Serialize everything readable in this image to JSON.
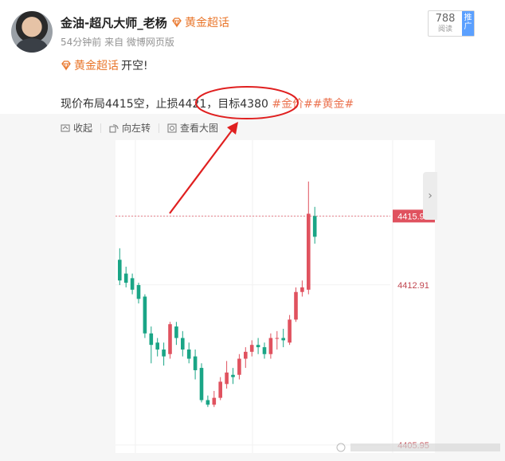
{
  "post": {
    "author": "金油-超凡大师_老杨",
    "badge": "黄金超话",
    "meta": "54分钟前  来自 微博网页版",
    "reads_count": "788",
    "reads_label": "阅读",
    "push_label": "推广",
    "topic": "黄金超话",
    "line1_text": "开空!",
    "line2_text": "现价布局4415空，止损4421，目标4380 ",
    "hashtags": "#金价##黄金#",
    "actions": {
      "collect": "收起",
      "rotate": "向左转",
      "view_large": "查看大图"
    }
  },
  "chart_data": {
    "type": "candlestick",
    "price_labels": [
      "4415.90",
      "4412.91",
      "4405.95"
    ],
    "current_price": 4415.9,
    "ylim": [
      4405.6,
      4419.2
    ],
    "candles": [
      {
        "o": 4414.0,
        "c": 4413.1,
        "h": 4414.5,
        "l": 4412.9
      },
      {
        "o": 4413.4,
        "c": 4413.0,
        "h": 4413.7,
        "l": 4412.8
      },
      {
        "o": 4413.2,
        "c": 4412.7,
        "h": 4413.4,
        "l": 4412.5
      },
      {
        "o": 4412.9,
        "c": 4412.3,
        "h": 4413.0,
        "l": 4412.1
      },
      {
        "o": 4412.4,
        "c": 4410.8,
        "h": 4412.5,
        "l": 4410.6
      },
      {
        "o": 4410.8,
        "c": 4410.3,
        "h": 4411.1,
        "l": 4409.5
      },
      {
        "o": 4410.4,
        "c": 4410.1,
        "h": 4410.6,
        "l": 4409.8
      },
      {
        "o": 4410.1,
        "c": 4409.8,
        "h": 4410.4,
        "l": 4409.4
      },
      {
        "o": 4409.9,
        "c": 4411.2,
        "h": 4411.3,
        "l": 4409.7
      },
      {
        "o": 4411.1,
        "c": 4410.6,
        "h": 4411.3,
        "l": 4410.3
      },
      {
        "o": 4410.6,
        "c": 4410.1,
        "h": 4410.9,
        "l": 4409.8
      },
      {
        "o": 4410.1,
        "c": 4409.7,
        "h": 4410.4,
        "l": 4409.5
      },
      {
        "o": 4409.8,
        "c": 4409.2,
        "h": 4410.1,
        "l": 4408.8
      },
      {
        "o": 4409.3,
        "c": 4407.9,
        "h": 4409.5,
        "l": 4407.8
      },
      {
        "o": 4407.9,
        "c": 4407.7,
        "h": 4408.1,
        "l": 4407.6
      },
      {
        "o": 4407.7,
        "c": 4408.0,
        "h": 4408.3,
        "l": 4407.6
      },
      {
        "o": 4408.0,
        "c": 4408.7,
        "h": 4408.9,
        "l": 4407.9
      },
      {
        "o": 4408.6,
        "c": 4409.1,
        "h": 4409.6,
        "l": 4408.4
      },
      {
        "o": 4409.0,
        "c": 4408.9,
        "h": 4409.3,
        "l": 4408.6
      },
      {
        "o": 4409.0,
        "c": 4409.7,
        "h": 4409.9,
        "l": 4408.8
      },
      {
        "o": 4409.7,
        "c": 4410.0,
        "h": 4410.2,
        "l": 4409.3
      },
      {
        "o": 4410.0,
        "c": 4410.3,
        "h": 4410.5,
        "l": 4409.8
      },
      {
        "o": 4410.3,
        "c": 4410.2,
        "h": 4410.6,
        "l": 4409.9
      },
      {
        "o": 4410.2,
        "c": 4409.9,
        "h": 4410.4,
        "l": 4409.7
      },
      {
        "o": 4409.9,
        "c": 4410.6,
        "h": 4410.8,
        "l": 4409.7
      },
      {
        "o": 4410.6,
        "c": 4410.6,
        "h": 4410.9,
        "l": 4410.1
      },
      {
        "o": 4410.6,
        "c": 4410.5,
        "h": 4411.0,
        "l": 4410.2
      },
      {
        "o": 4410.4,
        "c": 4411.4,
        "h": 4411.6,
        "l": 4410.3
      },
      {
        "o": 4411.4,
        "c": 4412.6,
        "h": 4412.8,
        "l": 4411.3
      },
      {
        "o": 4412.6,
        "c": 4412.8,
        "h": 4413.1,
        "l": 4412.4
      },
      {
        "o": 4412.7,
        "c": 4416.0,
        "h": 4417.4,
        "l": 4412.5
      },
      {
        "o": 4415.9,
        "c": 4415.0,
        "h": 4416.3,
        "l": 4414.7
      }
    ],
    "colors": {
      "up": "#e0525f",
      "down": "#1aa586",
      "current": "#e0525f",
      "annotation": "#e02020"
    }
  }
}
